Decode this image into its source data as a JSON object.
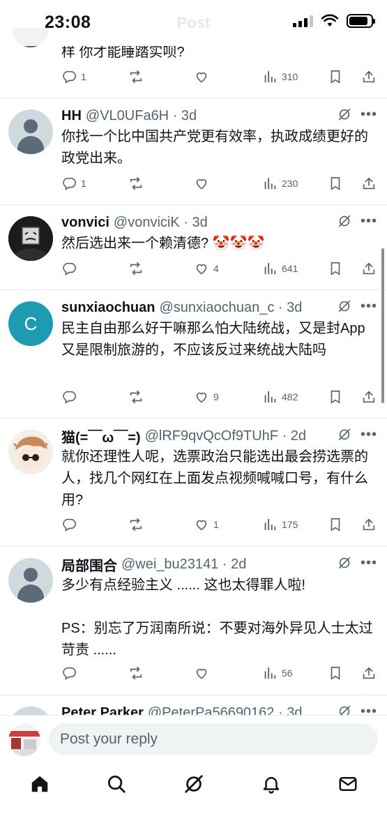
{
  "status_bar": {
    "time": "23:08",
    "ghost_title": "Post"
  },
  "posts": [
    {
      "text": "样 你才能睡踏实呗?",
      "stats": {
        "replies": "1",
        "retweets": "",
        "likes": "",
        "views": "310"
      }
    },
    {
      "name": "HH",
      "handle_time": "@VL0UFa6H · 3d",
      "text": "你找一个比中国共产党更有效率，执政成绩更好的政党出来。",
      "stats": {
        "replies": "1",
        "retweets": "",
        "likes": "",
        "views": "230"
      }
    },
    {
      "name": "vonvici",
      "handle_time": "@vonviciK · 3d",
      "text": "然后选出来一个赖清德? 🤡🤡🤡",
      "stats": {
        "replies": "",
        "retweets": "",
        "likes": "4",
        "views": "641"
      }
    },
    {
      "name": "sunxiaochuan",
      "handle_time": "@sunxiaochuan_c · 3d",
      "avatar_letter": "C",
      "text": "民主自由那么好干嘛那么怕大陆统战，又是封App又是限制旅游的，不应该反过来统战大陆吗",
      "stats": {
        "replies": "",
        "retweets": "",
        "likes": "9",
        "views": "482"
      }
    },
    {
      "name": "猫(=￣ω￣=)",
      "handle_time": "@lRF9qvQcOf9TUhF · 2d",
      "text": "就你还理性人呢，选票政治只能选出最会捞选票的人，找几个网红在上面发点视频喊喊口号，有什么用?",
      "stats": {
        "replies": "",
        "retweets": "",
        "likes": "1",
        "views": "175"
      }
    },
    {
      "name": "局部围合",
      "handle_time": "@wei_bu23141 · 2d",
      "text": "多少有点经验主义 ...... 这也太得罪人啦!\n\nPS：别忘了万润南所说：不要对海外异见人士太过苛责 ......",
      "stats": {
        "replies": "",
        "retweets": "",
        "likes": "",
        "views": "56"
      }
    },
    {
      "name": "Peter Parker",
      "handle_time": "@PeterPa56690162 · 3d"
    }
  ],
  "reply": {
    "placeholder": "Post your reply"
  },
  "nav": [
    "home-icon",
    "search-icon",
    "grok-icon",
    "notifications-icon",
    "messages-icon"
  ],
  "colors": {
    "text": "#0f1419",
    "secondary": "#536471",
    "divider": "#e8ebed",
    "avatar_letter_bg": "#1d9bb0"
  }
}
